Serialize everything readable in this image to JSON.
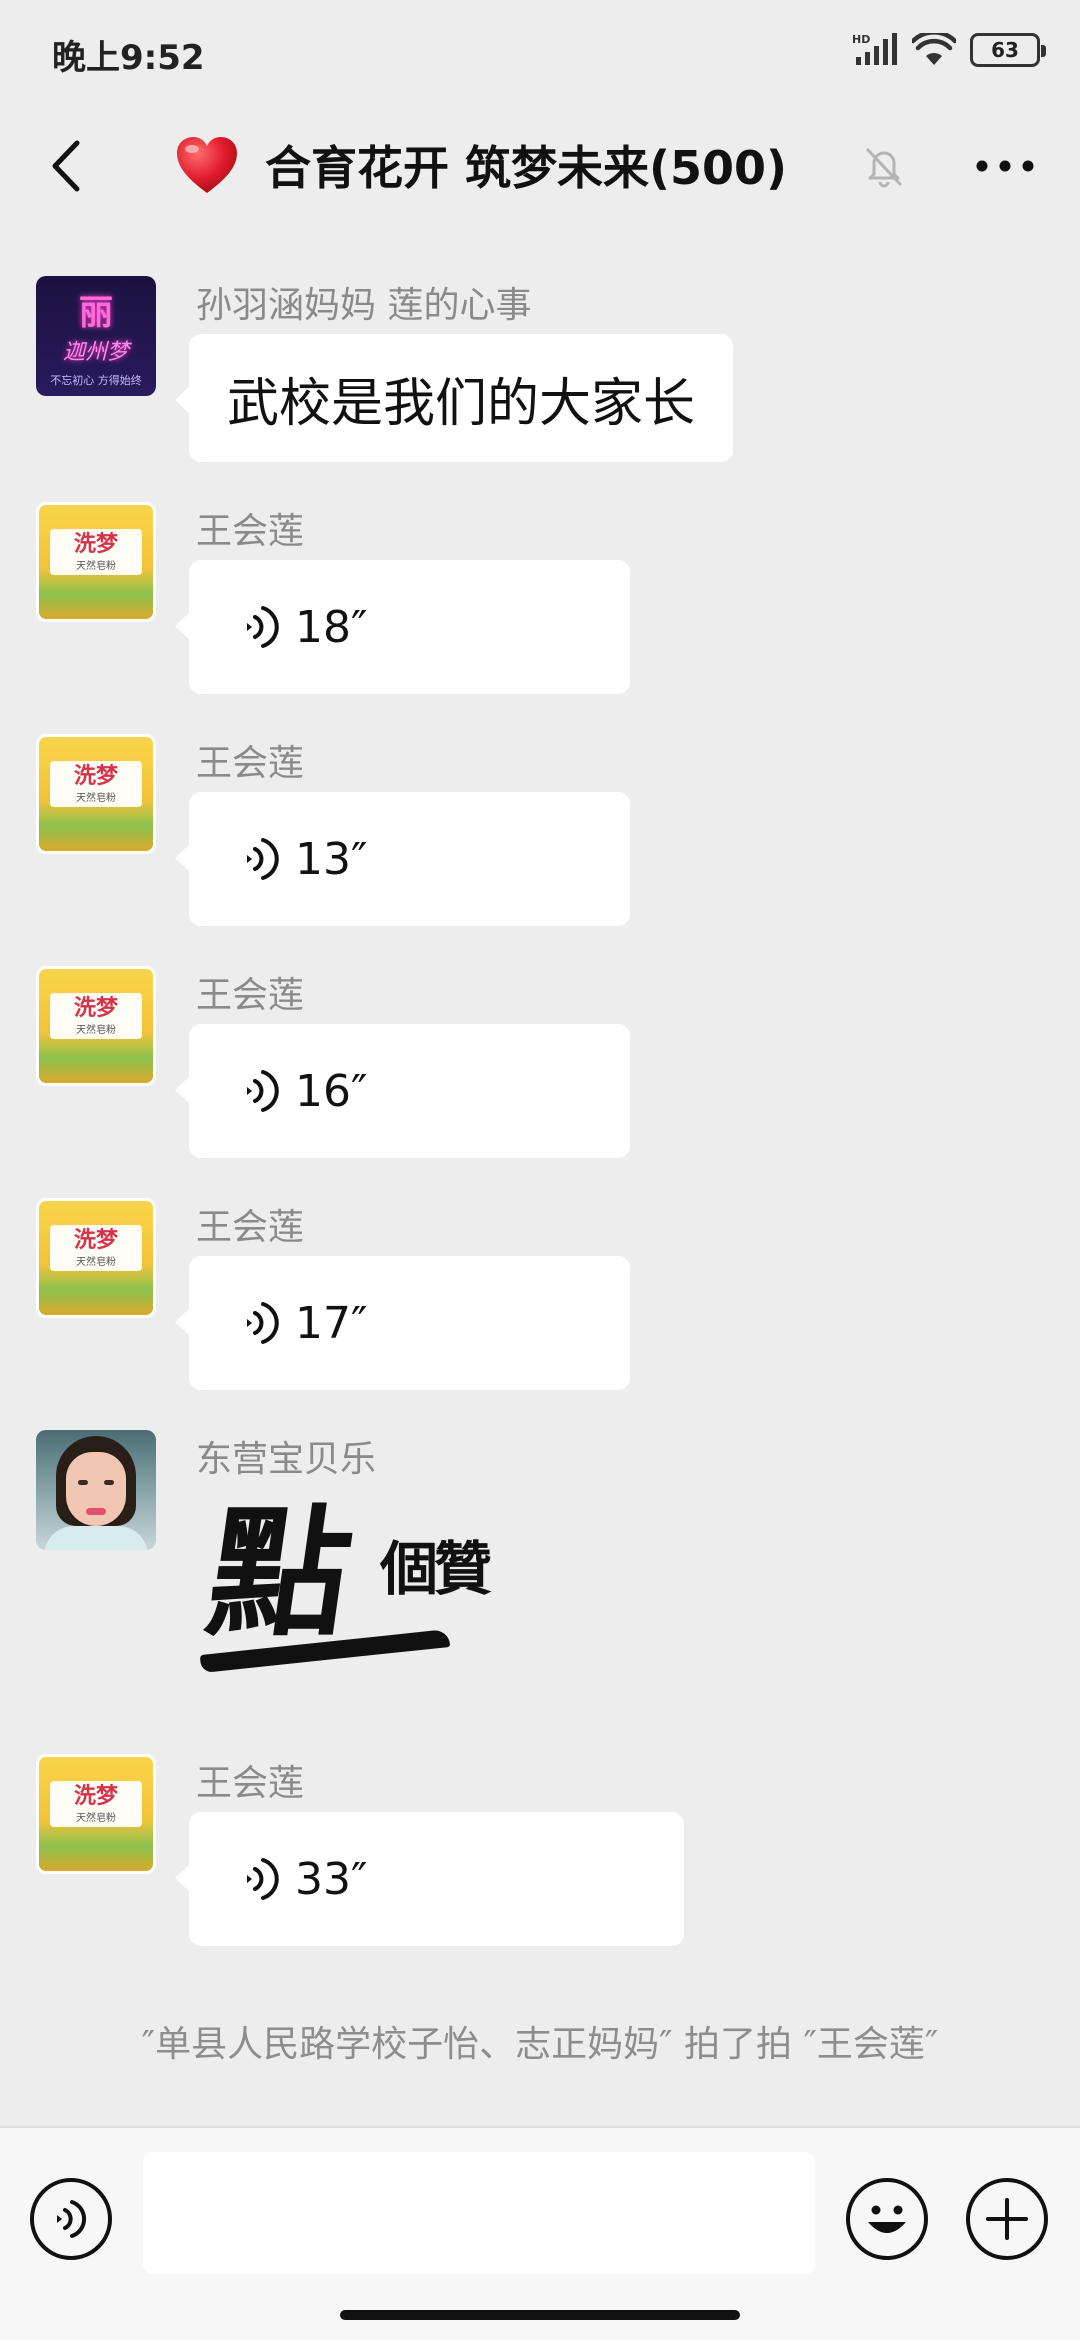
{
  "status_bar": {
    "time": "晚上9:52",
    "network_label": "HD",
    "battery": "63"
  },
  "header": {
    "title": "合育花开 筑梦未来(500)",
    "back_icon": "chevron-left-icon",
    "muted_icon": "bell-off-icon",
    "more_icon": "more-dots-icon"
  },
  "messages": [
    {
      "type": "text",
      "sender": "孙羽涵妈妈  莲的心事",
      "text": "武校是我们的大家长",
      "avatar": {
        "type": "neon",
        "top": "丽",
        "mid": "迦州梦",
        "bottom": "不忘初心 方得始终"
      }
    },
    {
      "type": "voice",
      "sender": "王会莲",
      "duration": "18″"
    },
    {
      "type": "voice",
      "sender": "王会莲",
      "duration": "13″"
    },
    {
      "type": "voice",
      "sender": "王会莲",
      "duration": "16″"
    },
    {
      "type": "voice",
      "sender": "王会莲",
      "duration": "17″"
    },
    {
      "type": "sticker",
      "sender": "东营宝贝乐",
      "sticker_text_big": "點",
      "sticker_text_small": "個贊"
    },
    {
      "type": "voice",
      "sender": "王会莲",
      "duration": "33″"
    }
  ],
  "avatar_bag": {
    "logo": "洗梦",
    "sub": "天然皂粉"
  },
  "system_notice": "″单县人民路学校子怡、志正妈妈″ 拍了拍 ″王会莲″",
  "input_bar": {
    "voice_icon": "voice-mode-icon",
    "input_value": "",
    "emoji_icon": "emoji-icon",
    "plus_icon": "plus-icon"
  }
}
